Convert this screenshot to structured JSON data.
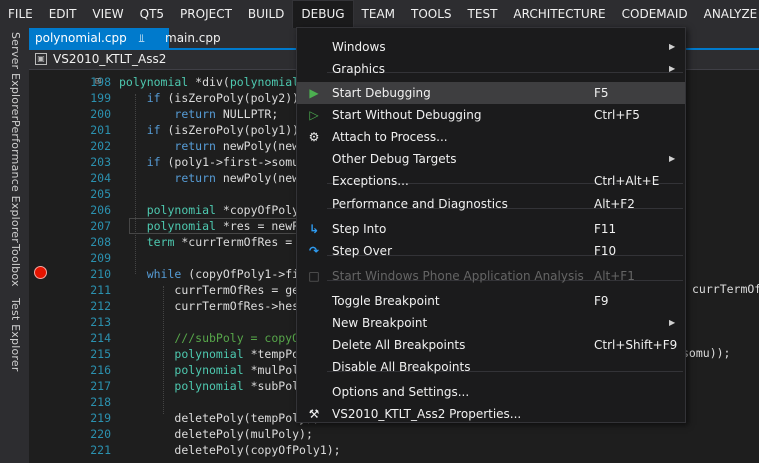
{
  "menubar": [
    "FILE",
    "EDIT",
    "VIEW",
    "QT5",
    "PROJECT",
    "BUILD",
    "DEBUG",
    "TEAM",
    "TOOLS",
    "TEST",
    "ARCHITECTURE",
    "CODEMAID",
    "ANALYZE"
  ],
  "active_menu": "DEBUG",
  "side_panels": [
    "Server Explorer",
    "Performance Explorer",
    "Toolbox",
    "Test Explorer"
  ],
  "tabs": [
    {
      "label": "polynomial.cpp",
      "active": true
    },
    {
      "label": "main.cpp",
      "active": false
    }
  ],
  "nav": {
    "project": "VS2010_KTLT_Ass2"
  },
  "code_lines": [
    {
      "n": "198",
      "text": "polynomial *div(polynomial"
    },
    {
      "n": "199",
      "text": "    if (isZeroPoly(poly2))"
    },
    {
      "n": "200",
      "text": "        return NULLPTR;"
    },
    {
      "n": "201",
      "text": "    if (isZeroPoly(poly1))"
    },
    {
      "n": "202",
      "text": "        return newPoly(newT"
    },
    {
      "n": "203",
      "text": "    if (poly1->first->somu"
    },
    {
      "n": "204",
      "text": "        return newPoly(newT"
    },
    {
      "n": "205",
      "text": ""
    },
    {
      "n": "206",
      "text": "    polynomial *copyOfPoly1"
    },
    {
      "n": "207",
      "text": "    polynomial *res = newPo"
    },
    {
      "n": "208",
      "text": "    term *currTermOfRes = N"
    },
    {
      "n": "209",
      "text": ""
    },
    {
      "n": "210",
      "text": "    while (copyOfPoly1->fir"
    },
    {
      "n": "211",
      "text": "        currTermOfRes = get"
    },
    {
      "n": "212",
      "text": "        currTermOfRes->heso"
    },
    {
      "n": "213",
      "text": ""
    },
    {
      "n": "214",
      "text": "        ///subPoly = copyOf"
    },
    {
      "n": "215",
      "text": "        polynomial *tempPol"
    },
    {
      "n": "216",
      "text": "        polynomial *mulPoly"
    },
    {
      "n": "217",
      "text": "        polynomial *subPoly"
    },
    {
      "n": "218",
      "text": ""
    },
    {
      "n": "219",
      "text": "        deletePoly(tempPoly);"
    },
    {
      "n": "220",
      "text": "        deletePoly(mulPoly);"
    },
    {
      "n": "221",
      "text": "        deletePoly(copyOfPoly1);"
    }
  ],
  "right_fragments": {
    "line211": "currTermOf",
    "line215": "somu));"
  },
  "debug_menu": [
    {
      "label": "Windows",
      "shortcut": "",
      "submenu": true,
      "icon": ""
    },
    {
      "label": "Graphics",
      "shortcut": "",
      "submenu": true,
      "icon": ""
    },
    {
      "label": "Start Debugging",
      "shortcut": "F5",
      "submenu": false,
      "icon": "play"
    },
    {
      "label": "Start Without Debugging",
      "shortcut": "Ctrl+F5",
      "submenu": false,
      "icon": "play-outline"
    },
    {
      "label": "Attach to Process...",
      "shortcut": "",
      "submenu": false,
      "icon": "gears"
    },
    {
      "label": "Other Debug Targets",
      "shortcut": "",
      "submenu": true,
      "icon": ""
    },
    {
      "label": "Exceptions...",
      "shortcut": "Ctrl+Alt+E",
      "submenu": false,
      "icon": ""
    },
    {
      "label": "Performance and Diagnostics",
      "shortcut": "Alt+F2",
      "submenu": false,
      "icon": ""
    },
    {
      "label": "Step Into",
      "shortcut": "F11",
      "submenu": false,
      "icon": "step-into"
    },
    {
      "label": "Step Over",
      "shortcut": "F10",
      "submenu": false,
      "icon": "step-over"
    },
    {
      "label": "Start Windows Phone Application Analysis",
      "shortcut": "Alt+F1",
      "submenu": false,
      "icon": "phone",
      "disabled": true
    },
    {
      "label": "Toggle Breakpoint",
      "shortcut": "F9",
      "submenu": false,
      "icon": ""
    },
    {
      "label": "New Breakpoint",
      "shortcut": "",
      "submenu": true,
      "icon": ""
    },
    {
      "label": "Delete All Breakpoints",
      "shortcut": "Ctrl+Shift+F9",
      "submenu": false,
      "icon": ""
    },
    {
      "label": "Disable All Breakpoints",
      "shortcut": "",
      "submenu": false,
      "icon": ""
    },
    {
      "label": "Options and Settings...",
      "shortcut": "",
      "submenu": false,
      "icon": ""
    },
    {
      "label": "VS2010_KTLT_Ass2 Properties...",
      "shortcut": "",
      "submenu": false,
      "icon": "wrench"
    }
  ],
  "colors": {
    "accent": "#007acc",
    "breakpoint": "#e51400",
    "line_number": "#2b91af"
  }
}
